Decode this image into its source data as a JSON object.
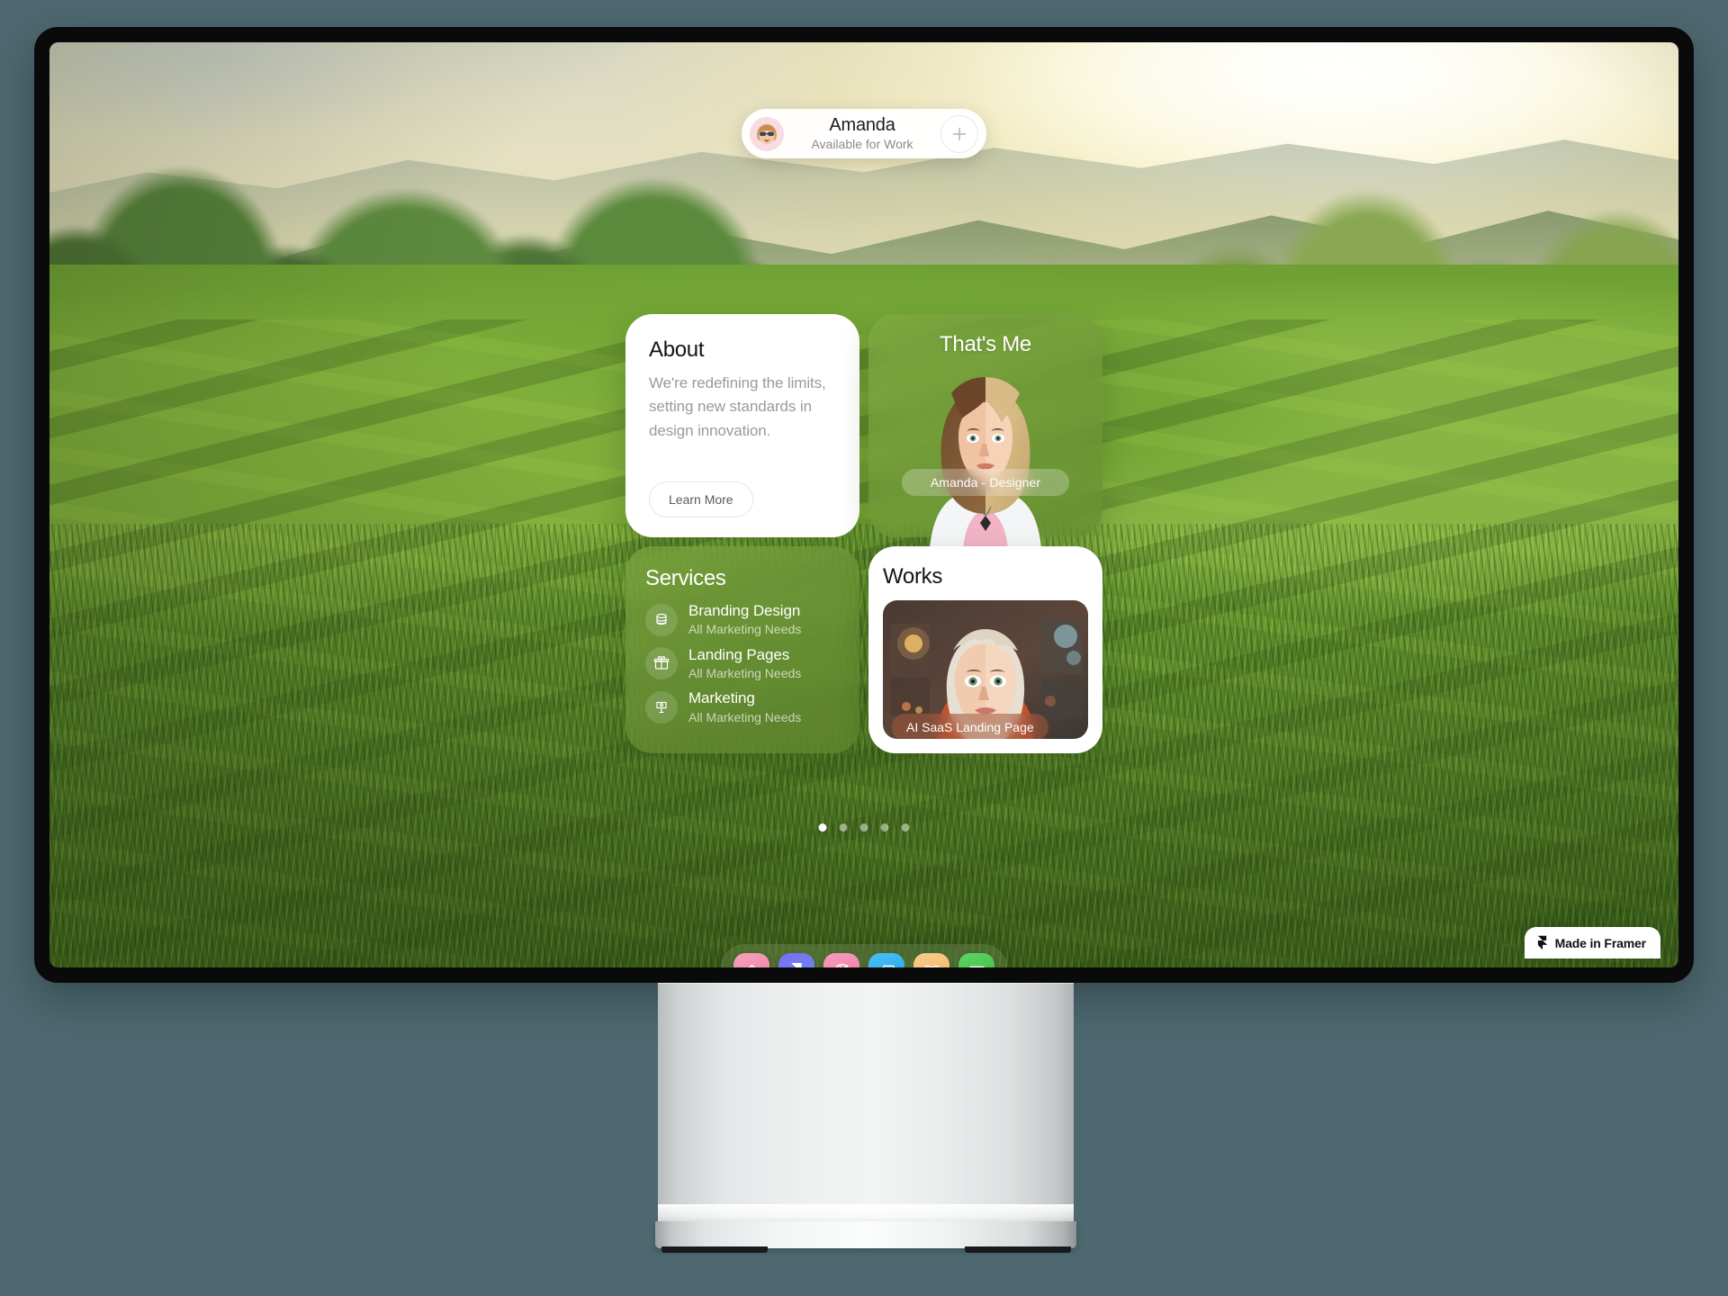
{
  "background": {
    "color": "#4d6870"
  },
  "wallpaper": {
    "name": "sunset-green-hills"
  },
  "header": {
    "name": "Amanda",
    "status": "Available for Work",
    "avatar_alt": "Amanda avatar",
    "add_label": "+"
  },
  "cards": {
    "about": {
      "title": "About",
      "body": "We're redefining the limits, setting new standards in design innovation.",
      "button": "Learn More"
    },
    "thats_me": {
      "title": "That's Me",
      "caption": "Amanda - Designer"
    },
    "services": {
      "title": "Services",
      "items": [
        {
          "name": "Branding Design",
          "sub": "All Marketing Needs",
          "icon": "paint-bucket-icon"
        },
        {
          "name": "Landing Pages",
          "sub": "All Marketing Needs",
          "icon": "gift-icon"
        },
        {
          "name": "Marketing",
          "sub": "All Marketing Needs",
          "icon": "signpost-icon"
        }
      ]
    },
    "works": {
      "title": "Works",
      "items": [
        {
          "caption": "AI SaaS Landing Page"
        }
      ]
    }
  },
  "pager": {
    "total": 5,
    "active_index": 0
  },
  "dock": {
    "items": [
      {
        "name": "home",
        "icon": "home-icon",
        "color": "#f489a8"
      },
      {
        "name": "framer",
        "icon": "framer-icon",
        "color": "#6f7df0"
      },
      {
        "name": "dribbble",
        "icon": "dribbble-icon",
        "color": "#f283a8"
      },
      {
        "name": "windows",
        "icon": "windows-icon",
        "color": "#35adf0"
      },
      {
        "name": "book",
        "icon": "book-icon",
        "color": "#f5bd72"
      },
      {
        "name": "mail",
        "icon": "mail-icon",
        "color": "#4bc552"
      }
    ]
  },
  "framer_badge": {
    "label": "Made in Framer",
    "icon": "framer-icon"
  }
}
